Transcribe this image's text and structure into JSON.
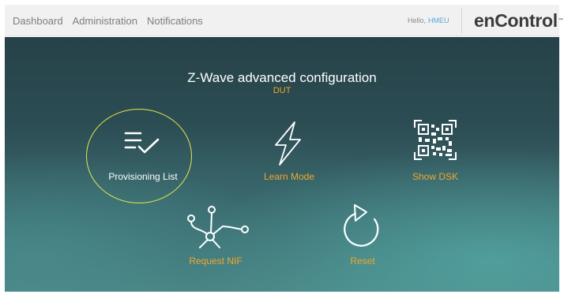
{
  "nav": {
    "items": [
      {
        "label": "Dashboard"
      },
      {
        "label": "Administration"
      },
      {
        "label": "Notifications"
      }
    ]
  },
  "user": {
    "greeting": "Hello,",
    "name": "HMEU"
  },
  "brand": {
    "logo": "enControl",
    "trademark": "™"
  },
  "main": {
    "title": "Z-Wave advanced configuration",
    "subtitle": "DUT",
    "tiles": [
      {
        "label": "Provisioning List",
        "icon": "list-check-icon",
        "selected": true
      },
      {
        "label": "Learn Mode",
        "icon": "lightning-icon"
      },
      {
        "label": "Show DSK",
        "icon": "qr-code-icon"
      },
      {
        "label": "Request NIF",
        "icon": "network-nodes-icon"
      },
      {
        "label": "Reset",
        "icon": "reset-icon"
      }
    ]
  },
  "colors": {
    "accent": "#f0a72b",
    "selection_ring": "#e6e54a",
    "link": "#5aa6d6"
  }
}
